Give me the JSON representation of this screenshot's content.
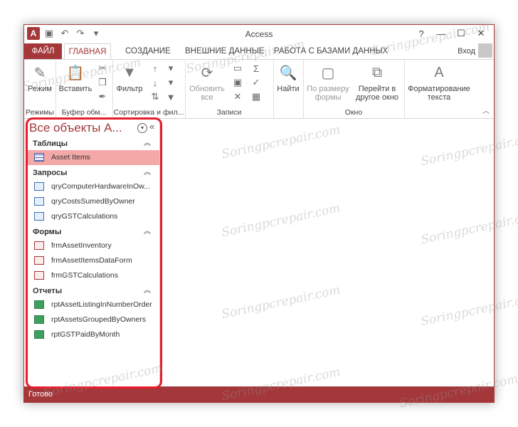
{
  "window": {
    "title": "Access"
  },
  "qat": {
    "logo": "A",
    "save_icon": "save-icon",
    "undo_icon": "undo-icon",
    "redo_icon": "redo-icon"
  },
  "controls": {
    "help": "?",
    "minimize": "—",
    "maximize": "☐",
    "close": "✕"
  },
  "tabs": [
    "ФАЙЛ",
    "ГЛАВНАЯ",
    "СОЗДАНИЕ",
    "ВНЕШНИЕ ДАННЫЕ",
    "РАБОТА С БАЗАМИ ДАННЫХ"
  ],
  "account": {
    "login": "Вход"
  },
  "ribbon": {
    "groups": [
      "Режимы",
      "Буфер обм...",
      "Сортировка и фил...",
      "Записи",
      "Найти",
      "Окно",
      "Форматирование текста"
    ],
    "buttons": {
      "view": "Режим",
      "paste": "Вставить",
      "filter": "Фильтр",
      "refresh": "Обновить все",
      "find": "Найти",
      "fit": "По размеру формы",
      "switch": "Перейти в другое окно",
      "format": "Форматирование текста"
    }
  },
  "nav": {
    "title": "Все объекты A...",
    "sections": [
      {
        "name": "Таблицы",
        "items": [
          {
            "label": "Asset Items",
            "type": "table",
            "selected": true
          }
        ]
      },
      {
        "name": "Запросы",
        "items": [
          {
            "label": "qryComputerHardwareInOw...",
            "type": "query"
          },
          {
            "label": "qryCostsSumedByOwner",
            "type": "query"
          },
          {
            "label": "qryGSTCalculations",
            "type": "query"
          }
        ]
      },
      {
        "name": "Формы",
        "items": [
          {
            "label": "frmAssetInventory",
            "type": "form"
          },
          {
            "label": "frmAssetItemsDataForm",
            "type": "form"
          },
          {
            "label": "frmGSTCalculations",
            "type": "form"
          }
        ]
      },
      {
        "name": "Отчеты",
        "items": [
          {
            "label": "rptAssetListingInNumberOrder",
            "type": "report"
          },
          {
            "label": "rptAssetsGroupedByOwners",
            "type": "report"
          },
          {
            "label": "rptGSTPaidByMonth",
            "type": "report"
          }
        ]
      }
    ]
  },
  "status": {
    "text": "Готово"
  },
  "watermark": "Soringpcrepair.com",
  "colors": {
    "accent": "#a4373a",
    "highlight": "#e81c2c",
    "selected": "#f4a8a8"
  }
}
